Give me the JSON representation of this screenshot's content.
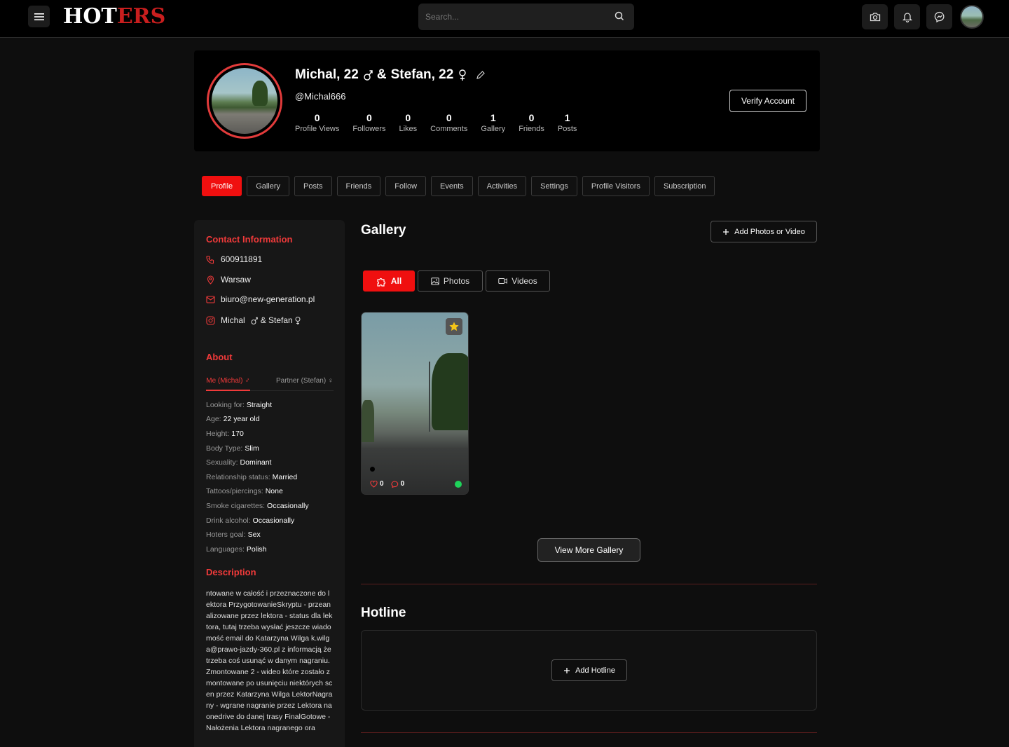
{
  "brand": {
    "logo_part1": "HOT",
    "logo_part2": "ERS"
  },
  "search": {
    "placeholder": "Search..."
  },
  "profile": {
    "name_person1": "Michal, 22",
    "name_separator": "&",
    "name_person2": "Stefan, 22",
    "handle": "@Michal666",
    "verify_label": "Verify Account",
    "stats": [
      {
        "value": "0",
        "label": "Profile Views"
      },
      {
        "value": "0",
        "label": "Followers"
      },
      {
        "value": "0",
        "label": "Likes"
      },
      {
        "value": "0",
        "label": "Comments"
      },
      {
        "value": "1",
        "label": "Gallery"
      },
      {
        "value": "0",
        "label": "Friends"
      },
      {
        "value": "1",
        "label": "Posts"
      }
    ]
  },
  "tabs": [
    "Profile",
    "Gallery",
    "Posts",
    "Friends",
    "Follow",
    "Events",
    "Activities",
    "Settings",
    "Profile Visitors",
    "Subscription"
  ],
  "active_tab": "Profile",
  "contact": {
    "title": "Contact Information",
    "phone": "600911891",
    "city": "Warsaw",
    "email": "biuro@new-generation.pl",
    "instagram_name1": "Michal",
    "instagram_sep": "& Stefan"
  },
  "about": {
    "title": "About",
    "tab_me": "Me (Michal)",
    "tab_partner": "Partner (Stefan)",
    "attributes": [
      {
        "label": "Looking for:",
        "value": "Straight"
      },
      {
        "label": "Age:",
        "value": "22 year old"
      },
      {
        "label": "Height:",
        "value": "170"
      },
      {
        "label": "Body Type:",
        "value": "Slim"
      },
      {
        "label": "Sexuality:",
        "value": "Dominant"
      },
      {
        "label": "Relationship status:",
        "value": "Married"
      },
      {
        "label": "Tattoos/piercings:",
        "value": "None"
      },
      {
        "label": "Smoke cigarettes:",
        "value": "Occasionally"
      },
      {
        "label": "Drink alcohol:",
        "value": "Occasionally"
      },
      {
        "label": "Hoters goal:",
        "value": "Sex"
      },
      {
        "label": "Languages:",
        "value": "Polish"
      }
    ]
  },
  "description": {
    "title": "Description",
    "text": "ntowane w całość i przeznaczone do lektora PrzygotowanieSkryptu - przeanalizowane przez lektora - status dla lektora, tutaj trzeba wysłać jeszcze wiadomość email do Katarzyna Wilga k.wilga@prawo-jazdy-360.pl z informacją że trzeba coś usunąć w danym nagraniu. Zmontowane 2 - wideo które zostało zmontowane po usunięciu niektórych scen przez Katarzyna Wilga LektorNagrany - wgrane nagranie przez Lektora na onedrive do danej trasy FinalGotowe - Nałożenia Lektora nagranego ora"
  },
  "gallery": {
    "title": "Gallery",
    "add_label": "Add Photos or Video",
    "filters": [
      "All",
      "Photos",
      "Videos"
    ],
    "active_filter": "All",
    "items": [
      {
        "likes": "0",
        "comments": "0"
      }
    ],
    "view_more_label": "View More Gallery"
  },
  "hotline": {
    "title": "Hotline",
    "add_label": "Add Hotline"
  },
  "colors": {
    "accent": "#f00f0f",
    "accent_text": "#f03a3a",
    "online": "#1ed35a",
    "background": "#0e0e0e"
  }
}
